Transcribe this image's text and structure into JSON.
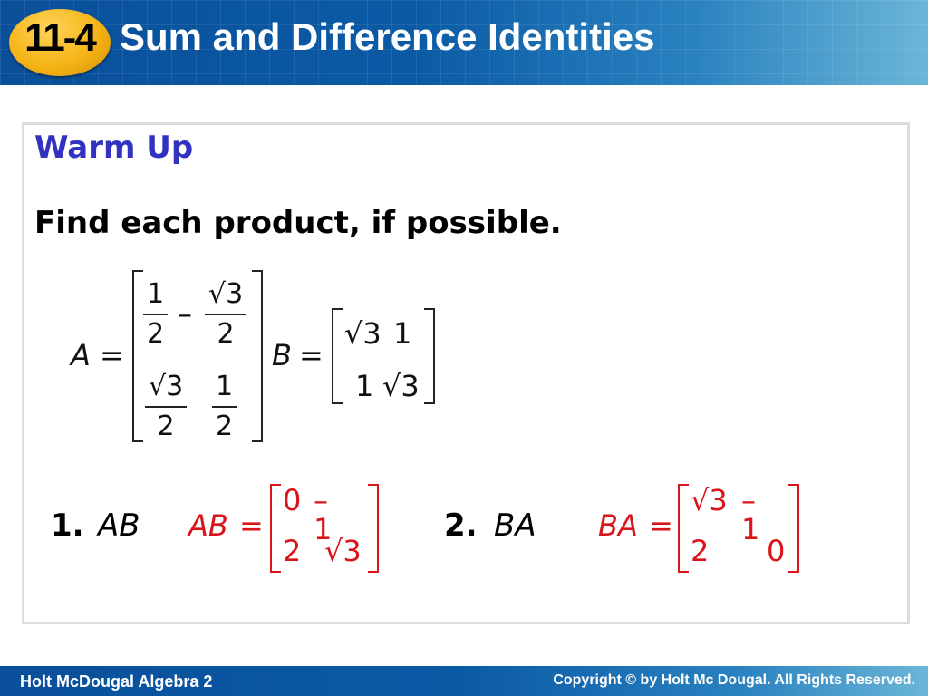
{
  "header": {
    "lesson_badge": "11-4",
    "title": "Sum and Difference Identities"
  },
  "content": {
    "heading": "Warm Up",
    "instruction": "Find each product, if possible.",
    "matrix_A": {
      "label": "A",
      "equals": "=",
      "rows": [
        [
          {
            "num": "1",
            "den": "2",
            "sign": ""
          },
          {
            "num": "√3",
            "den": "2",
            "sign": "–"
          }
        ],
        [
          {
            "num": "√3",
            "den": "2",
            "sign": ""
          },
          {
            "num": "1",
            "den": "2",
            "sign": ""
          }
        ]
      ]
    },
    "matrix_B": {
      "label": "B",
      "equals": "=",
      "rows": [
        [
          "√3",
          "1"
        ],
        [
          "1",
          "√3"
        ]
      ]
    },
    "problems": [
      {
        "number": "1.",
        "expression": "AB",
        "answer_label": "AB",
        "answer_equals": "=",
        "answer_rows": [
          [
            "0",
            "–1"
          ],
          [
            "2",
            "√3"
          ]
        ]
      },
      {
        "number": "2.",
        "expression": "BA",
        "answer_label": "BA",
        "answer_equals": "=",
        "answer_rows": [
          [
            "√3",
            "–1"
          ],
          [
            "2",
            "0"
          ]
        ]
      }
    ]
  },
  "footer": {
    "left": "Holt McDougal Algebra 2",
    "right": "Copyright © by Holt Mc Dougal. All Rights Reserved."
  },
  "colors": {
    "header_blue": "#0b5aa5",
    "badge_gold": "#f5b417",
    "heading_blue": "#3232c0",
    "answer_red": "#d9141a"
  }
}
